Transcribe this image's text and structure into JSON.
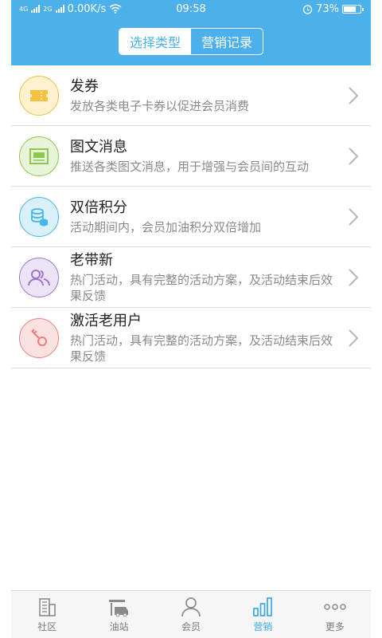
{
  "status": {
    "network_left": "4G",
    "network_right": "2G",
    "speed": "0.00K/s",
    "time": "09:58",
    "battery": "73%"
  },
  "header": {
    "segments": [
      {
        "label": "选择类型",
        "active": true
      },
      {
        "label": "营销记录",
        "active": false
      }
    ]
  },
  "items": [
    {
      "title": "发券",
      "desc": "发放各类电子卡券以促进会员消费",
      "icon": "ticket-icon"
    },
    {
      "title": "图文消息",
      "desc": "推送各类图文消息，用于增强与会员间的互动",
      "icon": "image-message-icon"
    },
    {
      "title": "双倍积分",
      "desc": "活动期间内，会员加油积分双倍增加",
      "icon": "coin-stack-icon"
    },
    {
      "title": "老带新",
      "desc": "热门活动，具有完整的活动方案，及活动结束后效果反馈",
      "icon": "users-icon"
    },
    {
      "title": "激活老用户",
      "desc": "热门活动，具有完整的活动方案，及活动结束后效果反馈",
      "icon": "key-icon"
    }
  ],
  "tabs": [
    {
      "label": "社区",
      "icon": "building-icon",
      "active": false
    },
    {
      "label": "油站",
      "icon": "gas-station-icon",
      "active": false
    },
    {
      "label": "会员",
      "icon": "person-icon",
      "active": false
    },
    {
      "label": "营销",
      "icon": "bar-chart-icon",
      "active": true
    },
    {
      "label": "更多",
      "icon": "more-dots-icon",
      "active": false
    }
  ],
  "colors": {
    "primary": "#4cb0ea",
    "ticket": "#f3c040",
    "image": "#8cc84b",
    "coin": "#45b6e6",
    "users": "#9b76c9",
    "key": "#ee7d7d"
  }
}
